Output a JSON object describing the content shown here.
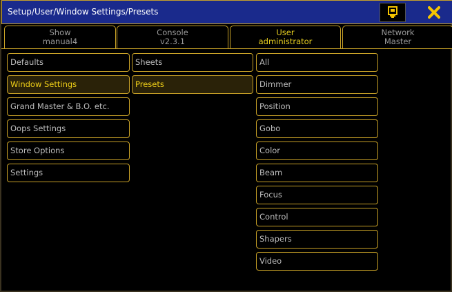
{
  "window": {
    "title": "Setup/User/Window Settings/Presets",
    "store_icon": "store-icon",
    "close_icon": "close-x-icon",
    "close_color": "#f5c400",
    "accent": "#c9a227"
  },
  "tabs": [
    {
      "line1": "Show",
      "line2": "manual4",
      "active": false
    },
    {
      "line1": "Console",
      "line2": "v2.3.1",
      "active": false
    },
    {
      "line1": "User",
      "line2": "administrator",
      "active": true
    },
    {
      "line1": "Network",
      "line2": "Master",
      "active": false
    }
  ],
  "column1": [
    {
      "label": "Defaults",
      "selected": false
    },
    {
      "label": "Window Settings",
      "selected": true
    },
    {
      "label": "Grand Master & B.O. etc.",
      "selected": false
    },
    {
      "label": "Oops Settings",
      "selected": false
    },
    {
      "label": "Store Options",
      "selected": false
    },
    {
      "label": "Settings",
      "selected": false
    }
  ],
  "column2": [
    {
      "label": "Sheets",
      "selected": false
    },
    {
      "label": "Presets",
      "selected": true
    }
  ],
  "column3": [
    {
      "label": "All",
      "selected": false
    },
    {
      "label": "Dimmer",
      "selected": false
    },
    {
      "label": "Position",
      "selected": false
    },
    {
      "label": "Gobo",
      "selected": false
    },
    {
      "label": "Color",
      "selected": false
    },
    {
      "label": "Beam",
      "selected": false
    },
    {
      "label": "Focus",
      "selected": false
    },
    {
      "label": "Control",
      "selected": false
    },
    {
      "label": "Shapers",
      "selected": false
    },
    {
      "label": "Video",
      "selected": false
    }
  ]
}
